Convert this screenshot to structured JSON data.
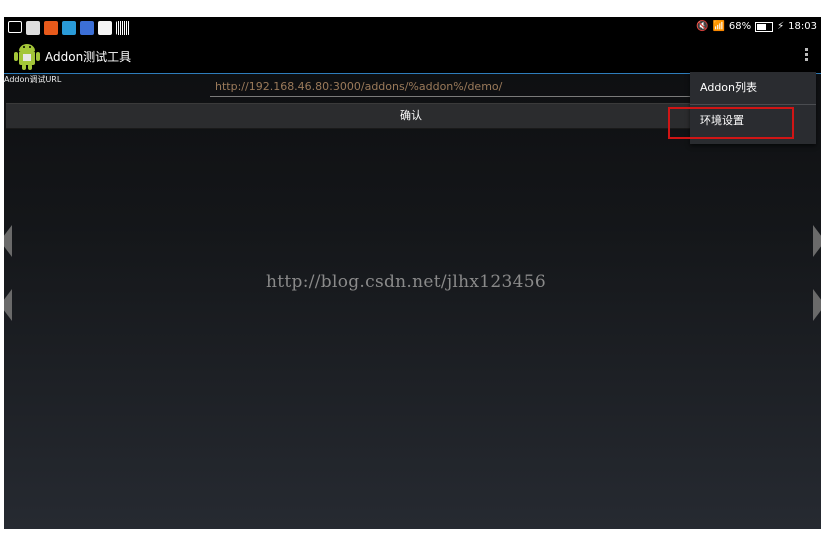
{
  "status_bar": {
    "battery": "68%",
    "time": "18:03"
  },
  "action_bar": {
    "title": "Addon测试工具"
  },
  "content": {
    "url_label": "Addon调试URL",
    "url_value": "http://192.168.46.80:3000/addons/%addon%/demo/",
    "confirm_label": "确认"
  },
  "menu": {
    "items": [
      "Addon列表",
      "环境设置"
    ]
  },
  "watermark": "http://blog.csdn.net/jlhx123456",
  "colors": {
    "accent_line": "#2e7dbb",
    "highlight_box": "#d01515"
  }
}
